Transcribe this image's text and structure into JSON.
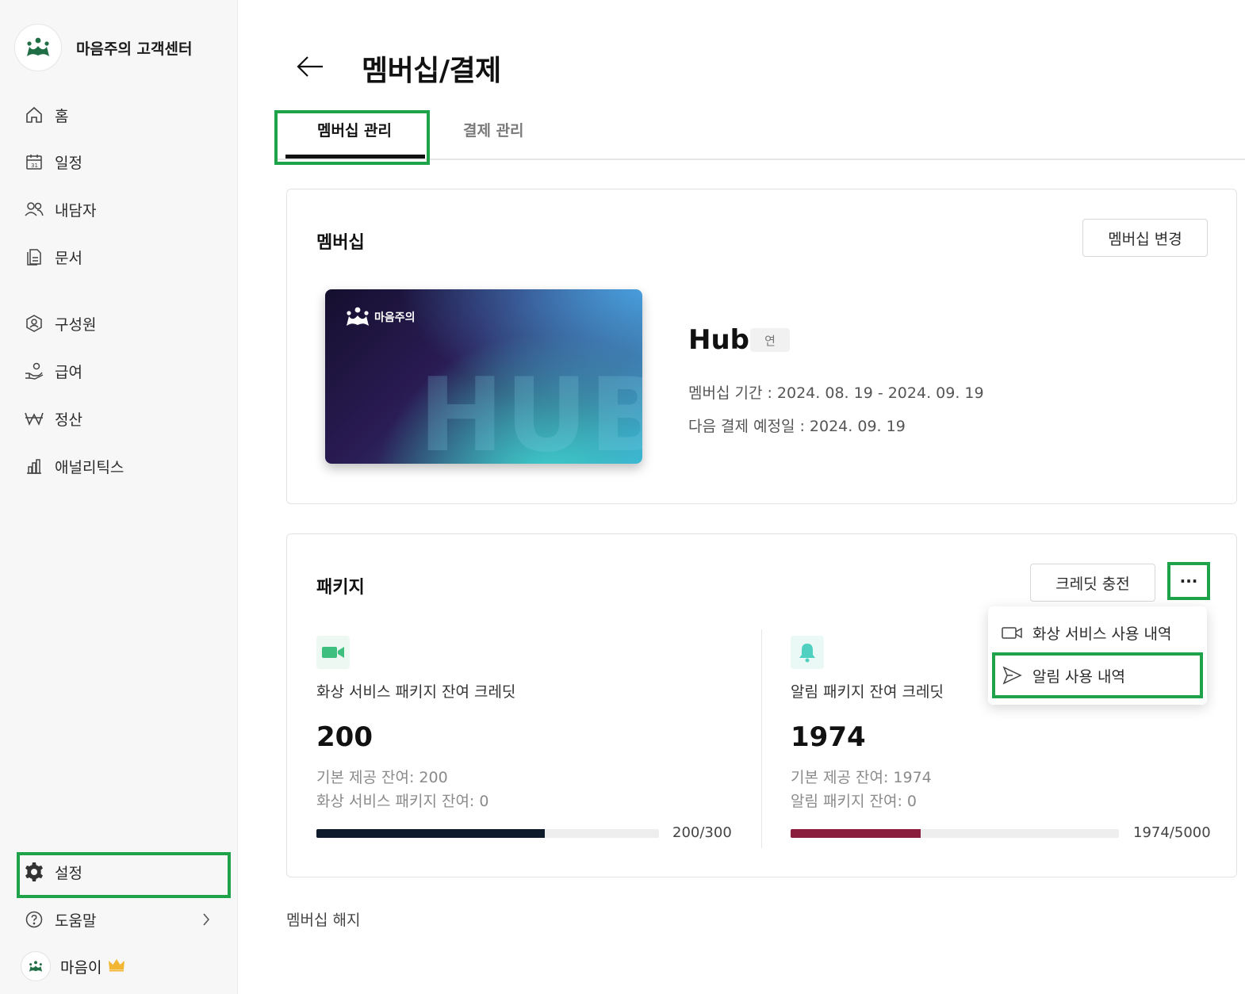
{
  "sidebar": {
    "brand": "마음주의 고객센터",
    "items": [
      {
        "label": "홈",
        "icon": "home-icon"
      },
      {
        "label": "일정",
        "icon": "calendar-icon"
      },
      {
        "label": "내담자",
        "icon": "users-icon"
      },
      {
        "label": "문서",
        "icon": "document-icon"
      },
      {
        "label": "구성원",
        "icon": "member-icon"
      },
      {
        "label": "급여",
        "icon": "salary-icon"
      },
      {
        "label": "정산",
        "icon": "won-icon"
      },
      {
        "label": "애널리틱스",
        "icon": "analytics-icon"
      },
      {
        "label": "설정",
        "icon": "gear-icon"
      },
      {
        "label": "도움말",
        "icon": "help-icon"
      }
    ],
    "user": {
      "name": "마음이"
    }
  },
  "header": {
    "title": "멤버십/결제"
  },
  "tabs": [
    {
      "label": "멤버십 관리",
      "active": true
    },
    {
      "label": "결제 관리",
      "active": false
    }
  ],
  "membership": {
    "title": "멤버십",
    "change_button": "멤버십 변경",
    "card_brand": "마음주의",
    "card_watermark": "HUB",
    "plan_name": "Hub",
    "plan_badge": "연",
    "period": "멤버십 기간 : 2024. 08. 19 - 2024. 09. 19",
    "next_payment": "다음 결제 예정일 : 2024. 09. 19"
  },
  "package": {
    "title": "패키지",
    "charge_button": "크레딧 충전",
    "more_button": "···",
    "video": {
      "label": "화상 서비스 패키지 잔여 크레딧",
      "value": "200",
      "basic": "기본 제공 잔여: 200",
      "package": "화상 서비스 패키지 잔여: 0",
      "progress_text": "200/300",
      "progress": 0.667,
      "color": "#0d1b2a"
    },
    "alarm": {
      "label": "알림 패키지 잔여 크레딧",
      "value": "1974",
      "basic": "기본 제공 잔여: 1974",
      "package": "알림 패키지 잔여: 0",
      "progress_text": "1974/5000",
      "progress": 0.395,
      "color": "#8a1c3e"
    },
    "menu": [
      {
        "label": "화상 서비스 사용 내역",
        "icon": "video-icon"
      },
      {
        "label": "알림 사용 내역",
        "icon": "send-icon"
      }
    ]
  },
  "cancel_link": "멤버십 해지",
  "colors": {
    "highlight": "#1fa34a",
    "brand_green": "#1f7a4a"
  }
}
